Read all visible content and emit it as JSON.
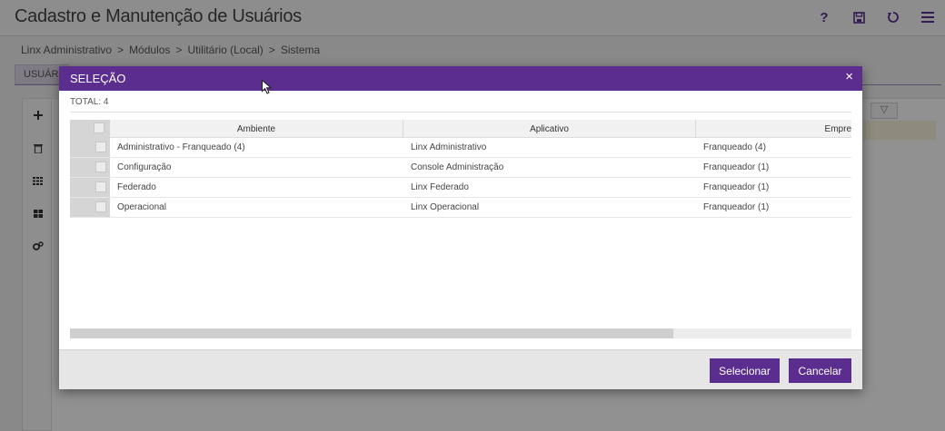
{
  "page": {
    "title": "Cadastro e Manutenção de Usuários",
    "tab_label": "USUÁRIO",
    "breadcrumb": [
      "Linx Administrativo",
      "Módulos",
      "Utilitário (Local)",
      "Sistema"
    ],
    "breadcrumb_sep": ">",
    "header_icons": [
      "help-icon",
      "save-icon",
      "refresh-icon",
      "menu-icon"
    ],
    "toolbar_icons": [
      "plus-icon",
      "trash-icon",
      "grid-icon",
      "tiles-icon",
      "settings-icon"
    ]
  },
  "modal": {
    "title": "SELEÇÃO",
    "close_glyph": "×",
    "total": "TOTAL: 4",
    "columns": [
      "Ambiente",
      "Aplicativo",
      "Empre"
    ],
    "rows": [
      {
        "ambiente": "Administrativo - Franqueado (4)",
        "aplicativo": "Linx Administrativo",
        "empresa": "Franqueado (4)"
      },
      {
        "ambiente": "Configuração",
        "aplicativo": "Console Administração",
        "empresa": "Franqueador (1)"
      },
      {
        "ambiente": "Federado",
        "aplicativo": "Linx Federado",
        "empresa": "Franqueador (1)"
      },
      {
        "ambiente": "Operacional",
        "aplicativo": "Linx Operacional",
        "empresa": "Franqueador (1)"
      }
    ],
    "buttons": {
      "select": "Selecionar",
      "cancel": "Cancelar"
    }
  },
  "colors": {
    "accent": "#5b2d8e"
  }
}
